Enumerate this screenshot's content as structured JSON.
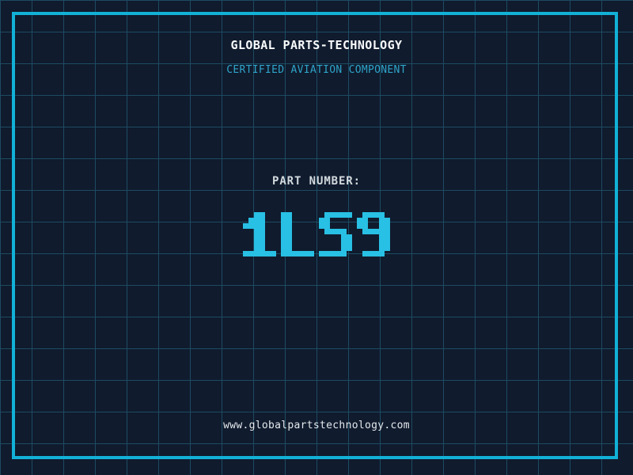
{
  "label": {
    "title": "GLOBAL PARTS-TECHNOLOGY",
    "subtitle": "CERTIFIED AVIATION COMPONENT",
    "part_label": "PART NUMBER:",
    "part_number": "1LS9",
    "website": "www.globalpartstechnology.com"
  },
  "colors": {
    "background": "#101b2e",
    "grid_line": "#1d4b61",
    "frame": "#12b1d7",
    "title": "#f8fafb",
    "subtitle": "#2ea4c8",
    "part_label": "#d3dade",
    "part_number": "#28c0e4",
    "website": "#e4e9ec"
  }
}
